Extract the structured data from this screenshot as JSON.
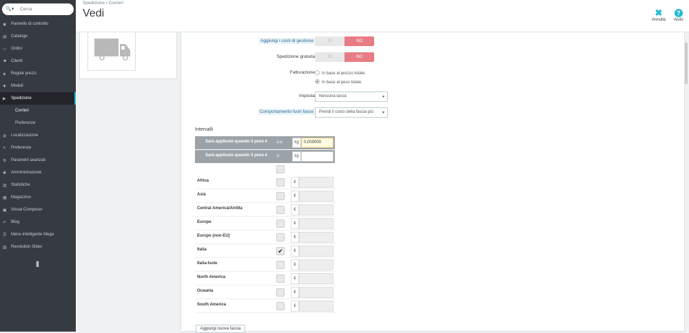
{
  "search": {
    "placeholder": "Cerca"
  },
  "sidebar": {
    "items": [
      {
        "label": "Pannello di controllo",
        "icon": "dashboard-icon"
      },
      {
        "label": "Catalogo",
        "icon": "catalog-icon"
      },
      {
        "label": "Ordini",
        "icon": "orders-icon"
      },
      {
        "label": "Clienti",
        "icon": "customers-icon"
      },
      {
        "label": "Regole prezzi",
        "icon": "price-rules-icon"
      },
      {
        "label": "Moduli",
        "icon": "modules-icon"
      },
      {
        "label": "Spedizione",
        "icon": "shipping-icon"
      },
      {
        "label": "Localizzazione",
        "icon": "localization-icon"
      },
      {
        "label": "Preferenze",
        "icon": "preferences-icon"
      },
      {
        "label": "Parametri avanzati",
        "icon": "advanced-params-icon"
      },
      {
        "label": "Amministrazione",
        "icon": "administration-icon"
      },
      {
        "label": "Statistiche",
        "icon": "stats-icon"
      },
      {
        "label": "Magazzino",
        "icon": "warehouse-icon"
      },
      {
        "label": "Visual Composer",
        "icon": "visual-composer-icon"
      },
      {
        "label": "Blog",
        "icon": "blog-icon"
      },
      {
        "label": "Menu intelligente Mega",
        "icon": "mega-menu-icon"
      },
      {
        "label": "Revolution Slider",
        "icon": "slider-icon"
      }
    ],
    "subitems": [
      "Corrieri",
      "Preferenze"
    ],
    "collapse": "|||"
  },
  "header": {
    "breadcrumb": "Spedizione  /  Corrieri",
    "title": "Vedi",
    "cancel_label": "Annulla",
    "help_label": "Aiuto"
  },
  "form": {
    "handling_label": "Aggiungi i costi di gestione",
    "free_label": "Spedizione gratuita",
    "yes": "SÌ",
    "no": "NO",
    "billing_label": "Fatturazione",
    "billing_opt1": "In base al prezzo totale.",
    "billing_opt2": "In base al peso totale.",
    "tax_label": "Imposta",
    "tax_value": "Nessuna tassa",
    "oor_label": "Comportamento fuori fasce",
    "oor_value": "Prendi il costo della fascia più"
  },
  "ranges": {
    "heading": "Intervalli",
    "row1_label": "Sarà applicato quando il peso è",
    "row1_op": ">=",
    "row2_label": "Sarà applicato quando il peso è",
    "row2_op": "<",
    "unit": "kg",
    "from_value": "0,000000",
    "to_value": "",
    "currency": "€",
    "zones": [
      {
        "name": "Africa",
        "checked": false
      },
      {
        "name": "Asia",
        "checked": false
      },
      {
        "name": "Central America/Antilla",
        "checked": false
      },
      {
        "name": "Europe",
        "checked": false
      },
      {
        "name": "Europe (non-EU)",
        "checked": false
      },
      {
        "name": "Italia",
        "checked": true
      },
      {
        "name": "Italia-Isole",
        "checked": false
      },
      {
        "name": "North America",
        "checked": false
      },
      {
        "name": "Oceania",
        "checked": false
      },
      {
        "name": "South America",
        "checked": false
      }
    ],
    "add_label": "Aggiungi nuova fascia"
  },
  "colors": {
    "accent": "#25b9d7",
    "no_toggle": "#e87c86",
    "sidebar": "#363a41"
  }
}
